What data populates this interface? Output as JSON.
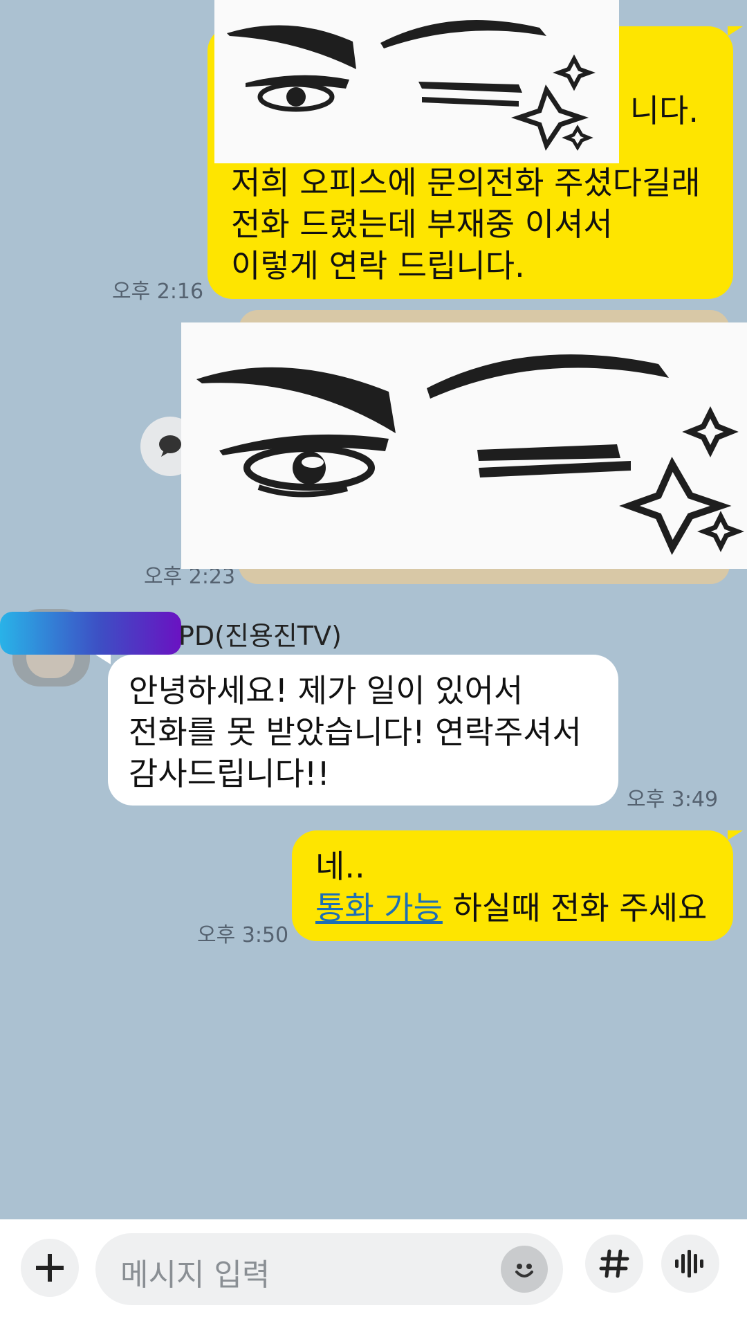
{
  "messages": {
    "m1": {
      "partial_line": "니다.",
      "lines": [
        "저희 오피스에 문의전화 주셨다길래",
        "전화 드렸는데 부재중 이셔서",
        "이렇게 연락 드립니다."
      ],
      "time": "오후 2:16"
    },
    "m2": {
      "time": "오후 2:23"
    },
    "m3": {
      "sender": "PD(진용진TV)",
      "lines": [
        "안녕하세요! 제가 일이 있어서",
        "전화를 못 받았습니다! 연락주셔서",
        "감사드립니다!!"
      ],
      "time": "오후 3:49"
    },
    "m4": {
      "line1": "네..",
      "link_text": "통화 가능",
      "line2_rest": " 하실때 전화 주세요",
      "time": "오후 3:50"
    }
  },
  "input": {
    "placeholder": "메시지 입력"
  },
  "icons": {
    "plus": "plus-icon",
    "emoji": "emoji-icon",
    "hashtag": "hashtag-icon",
    "voice": "voice-icon",
    "share": "share-icon"
  },
  "colors": {
    "background": "#abc1d1",
    "my_bubble": "#fee500",
    "other_bubble": "#ffffff",
    "link": "#1d6fb5"
  }
}
